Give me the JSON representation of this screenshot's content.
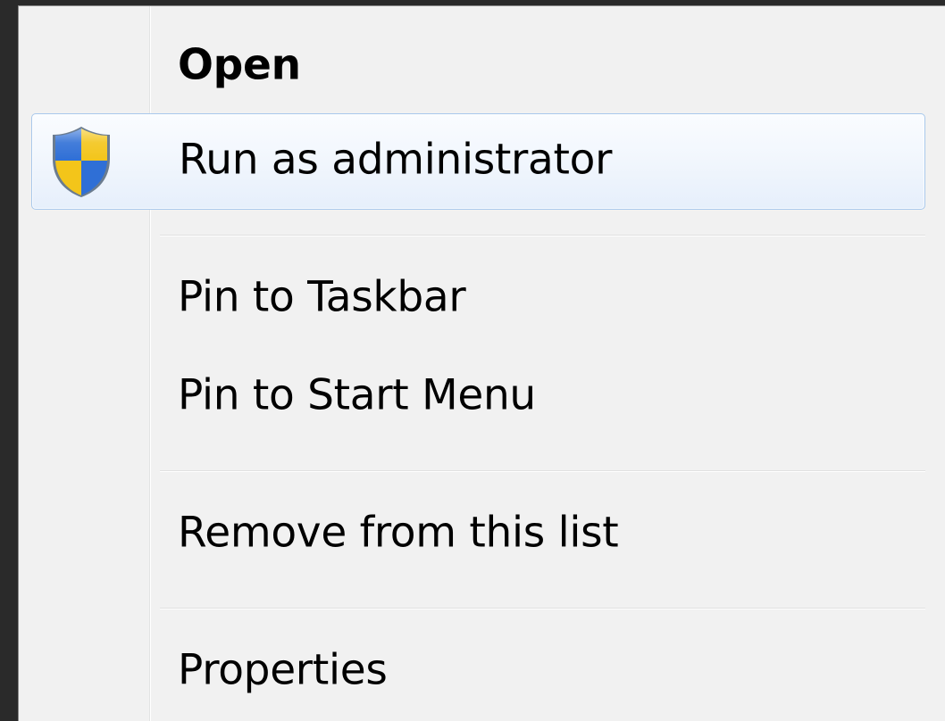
{
  "context_menu": {
    "items": [
      {
        "label": "Open",
        "bold": true
      },
      {
        "label": "Run as administrator",
        "icon": "uac-shield-icon",
        "highlighted": true
      },
      {
        "label": "Pin to Taskbar"
      },
      {
        "label": "Pin to Start Menu"
      },
      {
        "label": "Remove from this list"
      },
      {
        "label": "Properties"
      }
    ]
  },
  "colors": {
    "menu_background": "#f1f1f1",
    "highlight_border": "#a8c8ec",
    "shield_blue": "#2f6fd6",
    "shield_yellow": "#f3c51a"
  }
}
